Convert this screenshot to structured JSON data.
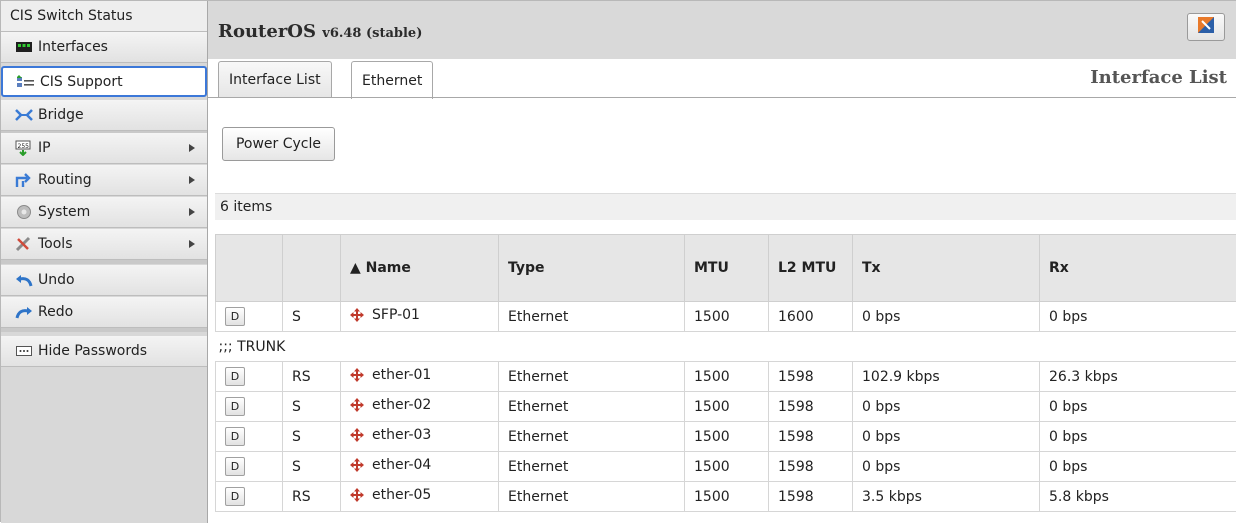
{
  "sidebar": {
    "header": "CIS Switch Status",
    "items": [
      {
        "label": "Interfaces",
        "icon": "interfaces-icon",
        "submenu": false
      },
      {
        "label": "CIS Support",
        "icon": "cis-support-icon",
        "submenu": false,
        "active": true
      },
      {
        "label": "Bridge",
        "icon": "bridge-icon",
        "submenu": false
      },
      {
        "label": "IP",
        "icon": "ip-icon",
        "submenu": true
      },
      {
        "label": "Routing",
        "icon": "routing-icon",
        "submenu": true
      },
      {
        "label": "System",
        "icon": "system-icon",
        "submenu": true
      },
      {
        "label": "Tools",
        "icon": "tools-icon",
        "submenu": true
      },
      {
        "label": "Undo",
        "icon": "undo-icon",
        "submenu": false
      },
      {
        "label": "Redo",
        "icon": "redo-icon",
        "submenu": false
      },
      {
        "label": "Hide Passwords",
        "icon": "hide-passwords-icon",
        "submenu": false
      }
    ]
  },
  "header": {
    "product": "RouterOS",
    "version": "v6.48 (stable)"
  },
  "tabs": [
    {
      "label": "Interface List",
      "active": false
    },
    {
      "label": "Ethernet",
      "active": true
    }
  ],
  "page_heading": "Interface List",
  "actions": {
    "power_cycle": "Power Cycle"
  },
  "item_count": "6 items",
  "table": {
    "columns": [
      "",
      "",
      "▲ Name",
      "Type",
      "MTU",
      "L2 MTU",
      "Tx",
      "Rx"
    ],
    "rows": [
      {
        "btn": "D",
        "flags": "S",
        "name": "SFP-01",
        "type": "Ethernet",
        "mtu": "1500",
        "l2mtu": "1600",
        "tx": "0 bps",
        "rx": "0 bps"
      },
      {
        "comment": ";;; TRUNK"
      },
      {
        "btn": "D",
        "flags": "RS",
        "name": "ether-01",
        "type": "Ethernet",
        "mtu": "1500",
        "l2mtu": "1598",
        "tx": "102.9 kbps",
        "rx": "26.3 kbps"
      },
      {
        "btn": "D",
        "flags": "S",
        "name": "ether-02",
        "type": "Ethernet",
        "mtu": "1500",
        "l2mtu": "1598",
        "tx": "0 bps",
        "rx": "0 bps"
      },
      {
        "btn": "D",
        "flags": "S",
        "name": "ether-03",
        "type": "Ethernet",
        "mtu": "1500",
        "l2mtu": "1598",
        "tx": "0 bps",
        "rx": "0 bps"
      },
      {
        "btn": "D",
        "flags": "S",
        "name": "ether-04",
        "type": "Ethernet",
        "mtu": "1500",
        "l2mtu": "1598",
        "tx": "0 bps",
        "rx": "0 bps"
      },
      {
        "btn": "D",
        "flags": "RS",
        "name": "ether-05",
        "type": "Ethernet",
        "mtu": "1500",
        "l2mtu": "1598",
        "tx": "3.5 kbps",
        "rx": "5.8 kbps"
      }
    ]
  },
  "colors": {
    "active_outline": "#3c78d8",
    "interface_icon": "#c0392b"
  }
}
